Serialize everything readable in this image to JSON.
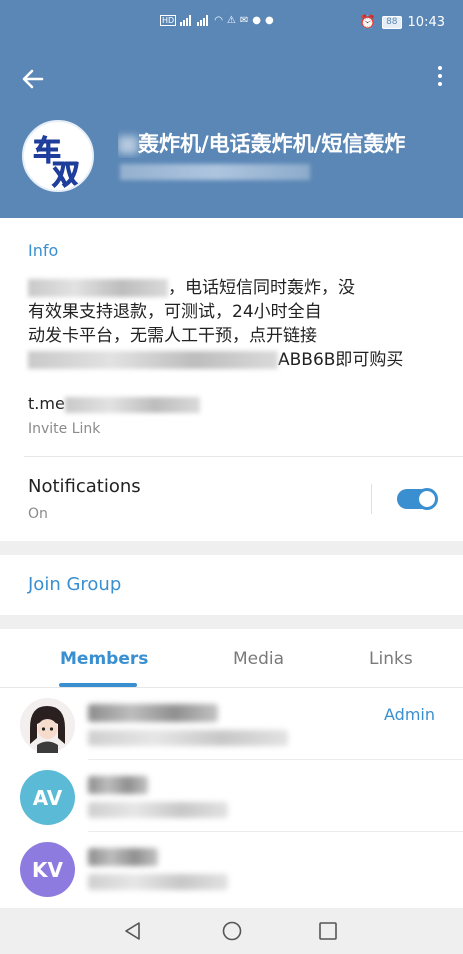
{
  "status_bar": {
    "time": "10:43",
    "battery": "88"
  },
  "header": {
    "title": "轰炸机/电话轰炸机/短信轰炸",
    "avatar_text": "车双"
  },
  "info": {
    "label": "Info",
    "desc_line1": "，电话短信同时轰炸，没",
    "desc_line2": "有效果支持退款，可测试，24小时全自",
    "desc_line3": "动发卡平台，无需人工干预，点开链接",
    "desc_line4": "ABB6B即可购买",
    "link_prefix": "t.me",
    "link_caption": "Invite Link"
  },
  "notifications": {
    "label": "Notifications",
    "status": "On",
    "enabled": true
  },
  "join_group": {
    "label": "Join Group"
  },
  "tabs": {
    "members": "Members",
    "media": "Media",
    "links": "Links"
  },
  "members": [
    {
      "initials": "",
      "role": "Admin",
      "color": "#f0e8e8"
    },
    {
      "initials": "AV",
      "role": "",
      "color": "#5bbad5"
    },
    {
      "initials": "KV",
      "role": "",
      "color": "#8e7be0"
    }
  ],
  "colors": {
    "header": "#5b87b6",
    "accent": "#3a8fd0",
    "background": "#efefef"
  }
}
